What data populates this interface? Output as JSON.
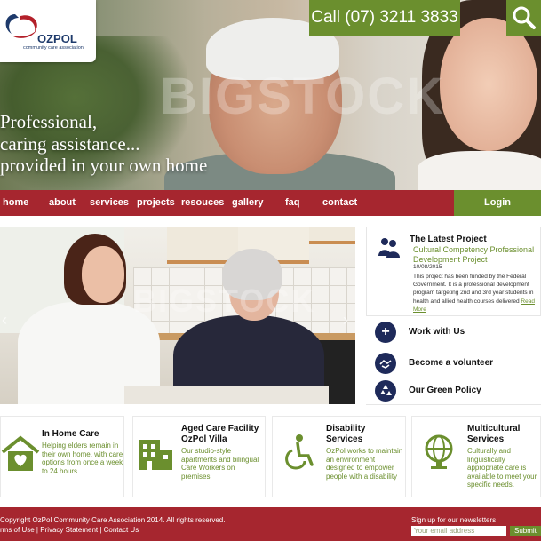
{
  "header": {
    "logo_name": "OZPOL",
    "logo_sub": "community care association",
    "phone": "Call (07) 3211 3833",
    "tagline": [
      "Professional,",
      "caring assistance...",
      "provided in your own home"
    ],
    "watermark": "BIGSTOCK"
  },
  "nav": {
    "items": [
      "home",
      "about",
      "services",
      "projects",
      "resouces",
      "gallery",
      "faq",
      "contact"
    ],
    "login": "Login"
  },
  "sidebar": {
    "latest": {
      "title": "The Latest Project",
      "subtitle": "Cultural Competency Professional Development Project",
      "date": "10/08/2015",
      "body": "This project has been funded by the Federal Government. It is a professional development program targeting 2nd and 3rd year students in health and allied health courses delivered",
      "read_more": "Read More"
    },
    "links": [
      {
        "label": "Work with Us",
        "icon": "plus-icon"
      },
      {
        "label": "Become a volunteer",
        "icon": "handshake-icon"
      },
      {
        "label": "Our Green Policy",
        "icon": "recycle-icon"
      }
    ]
  },
  "services": [
    {
      "title": "In Home Care",
      "text": "Helping elders remain in their own home, with care options from once a week to 24 hours",
      "icon": "house-heart-icon"
    },
    {
      "title": "Aged Care Facility OzPol Villa",
      "text": "Our studio-style apartments and bilingual Care Workers on premises.",
      "icon": "building-icon"
    },
    {
      "title": "Disability Services",
      "text": "OzPol works to maintain an environment designed to empower people with a disability",
      "icon": "wheelchair-icon"
    },
    {
      "title": "Multicultural Services",
      "text": "Culturally and linguistically appropriate care is available to meet your specific needs.",
      "icon": "globe-icon"
    }
  ],
  "footer": {
    "copyright": "Copyright OzPol Community Care Association 2014. All rights reserved.",
    "links": "rms of Use | Privacy Statement | Contact Us",
    "newsletter_label": "Sign up for our newsletters",
    "email_placeholder": "Your email address",
    "submit": "Submit"
  },
  "colors": {
    "brand_red": "#a6262f",
    "brand_green": "#6b8f2e",
    "icon_navy": "#1e2a5a"
  }
}
